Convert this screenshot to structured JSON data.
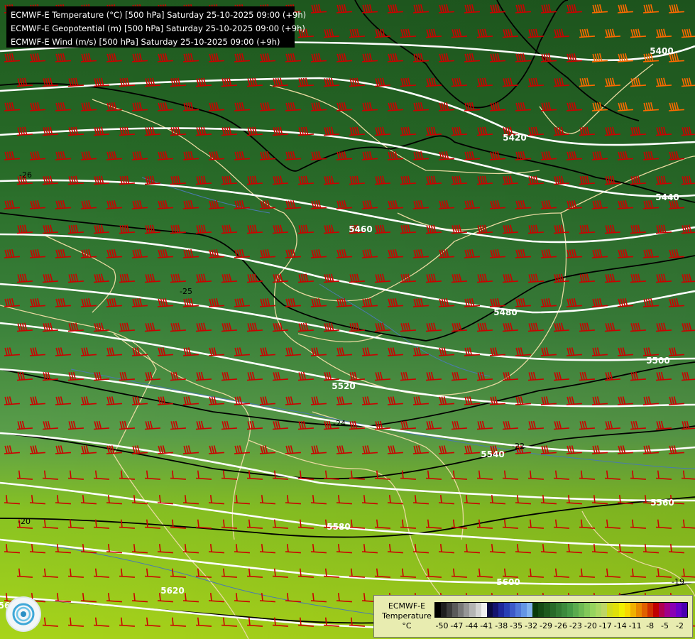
{
  "header": {
    "line1": "ECMWF-E Temperature (°C) [500 hPa] Saturday 25-10-2025 09:00 (+9h)",
    "line2": "ECMWF-E Geopotential (m) [500 hPa] Saturday 25-10-2025 09:00 (+9h)",
    "line3": "ECMWF-E Wind (m/s) [500 hPa] Saturday 25-10-2025 09:00 (+9h)"
  },
  "legend": {
    "title_line1": "ECMWF-E",
    "title_line2": "Temperature",
    "unit": "°C",
    "ticks": [
      "-50",
      "-47",
      "-44",
      "-41",
      "-38",
      "-35",
      "-32",
      "-29",
      "-26",
      "-23",
      "-20",
      "-17",
      "-14",
      "-11",
      "-8",
      "-5",
      "-2"
    ],
    "colors": [
      "#000000",
      "#1e1e1e",
      "#3c3c3c",
      "#5a5a5a",
      "#787878",
      "#969696",
      "#b4b4b4",
      "#d2d2d2",
      "#f0f0f0",
      "#0a0a40",
      "#14146e",
      "#1e289a",
      "#2840b4",
      "#3c5ac8",
      "#5078d8",
      "#6496e4",
      "#82b4ee",
      "#0a3a0a",
      "#144a14",
      "#1e5a1e",
      "#286a28",
      "#327a32",
      "#3c8a3c",
      "#469a46",
      "#5aaa4e",
      "#6eba54",
      "#82c85a",
      "#96d45e",
      "#aad862",
      "#bed666",
      "#d2dc1e",
      "#e0e00a",
      "#f0f000",
      "#f8d800",
      "#f0b000",
      "#e88800",
      "#e06000",
      "#d03000",
      "#c00000",
      "#b00050",
      "#a0008a",
      "#8a00b4",
      "#6a00c8",
      "#4a00b0"
    ]
  },
  "geopotential_labels": [
    "5400",
    "5420",
    "5440",
    "5460",
    "5480",
    "5500",
    "5520",
    "5540",
    "5560",
    "5580",
    "5600",
    "5620",
    "56"
  ],
  "temperature_labels": [
    "-26",
    "-25",
    "-24",
    "-22",
    "-20",
    "-19"
  ],
  "colors": {
    "isohypse": "#ffffff",
    "isotherm": "#000000",
    "wind_barb": "#cc0000",
    "wind_barb_strong": "#ff6a00",
    "borders": "#e8d9a0",
    "rivers": "#4a7ab0"
  },
  "logo_icon": "ecmwf-logo-icon"
}
